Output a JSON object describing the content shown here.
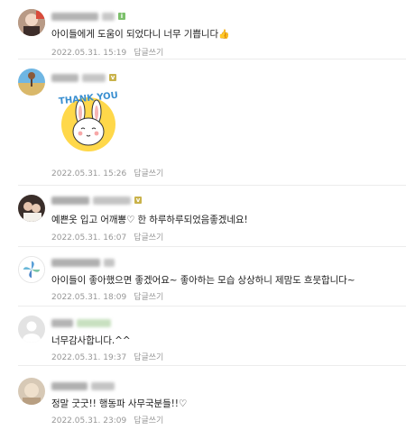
{
  "comments": [
    {
      "text": "아이들에게 도움이 되었다니 너무 기쁩니다",
      "emoji": "👍",
      "date": "2022.05.31. 15:19",
      "reply_label": "답글쓰기",
      "badge": "green"
    },
    {
      "sticker_text": "THANK YOU",
      "date": "2022.05.31. 15:26",
      "reply_label": "답글쓰기",
      "badge": "yellow"
    },
    {
      "text": "예쁜옷 입고 어깨뽕♡ 한 하루하루되었음좋겠네요!",
      "date": "2022.05.31. 16:07",
      "reply_label": "답글쓰기",
      "badge": "yellow"
    },
    {
      "text": "아이들이 좋아했으면 좋겠어요~ 좋아하는 모습 상상하니 제맘도 흐뭇합니다~",
      "date": "2022.05.31. 18:09",
      "reply_label": "답글쓰기"
    },
    {
      "text": "너무감사합니다.^^",
      "date": "2022.05.31. 19:37",
      "reply_label": "답글쓰기"
    },
    {
      "text": "정말 굿굿!! 행동파 사무국분들!!♡",
      "date": "2022.05.31. 23:09",
      "reply_label": "답글쓰기"
    }
  ],
  "colors": {
    "badge_green": "#7cc06b",
    "badge_yellow": "#c9b24a",
    "meta": "#979797",
    "divider": "#ececec"
  }
}
